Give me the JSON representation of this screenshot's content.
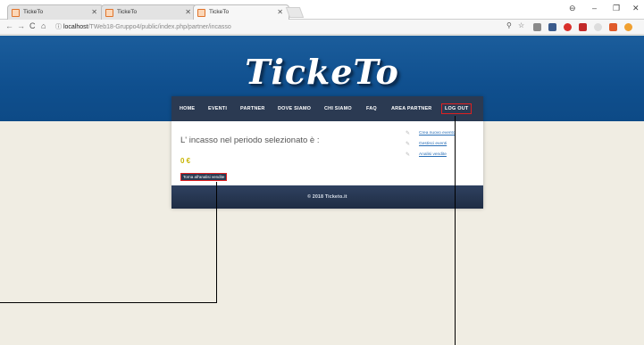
{
  "browser": {
    "tabs": [
      {
        "title": "TickeTo",
        "active": false
      },
      {
        "title": "TickeTo",
        "active": false
      },
      {
        "title": "TickeTo",
        "active": true
      }
    ],
    "url_host": "localhost",
    "url_path": "/TWeb18-Gruppo4/public/index.php/partner/incasso"
  },
  "site": {
    "logo": "TickeTo",
    "menu": [
      "HOME",
      "EVENTI",
      "PARTNER",
      "DOVE SIAMO",
      "CHI SIAMO",
      "FAQ",
      "AREA PARTNER",
      "LOG OUT"
    ],
    "income_title": "L' incasso nel periodo selezionato è :",
    "income_value": "0 €",
    "back_button": "Torna all'analisi vendite",
    "side_links": [
      "Crea nuovo evento",
      "Gestisci eventi",
      "Analisi vendite"
    ],
    "footer": "© 2018 Ticketo.it"
  },
  "colors": {
    "header_blue": "#0f4f8e",
    "menu_dark": "#2b3a52",
    "page_bg": "#f0ede3",
    "highlight_red": "#e02020",
    "value_yellow": "#c8b400",
    "link_blue": "#2a6fb6"
  }
}
